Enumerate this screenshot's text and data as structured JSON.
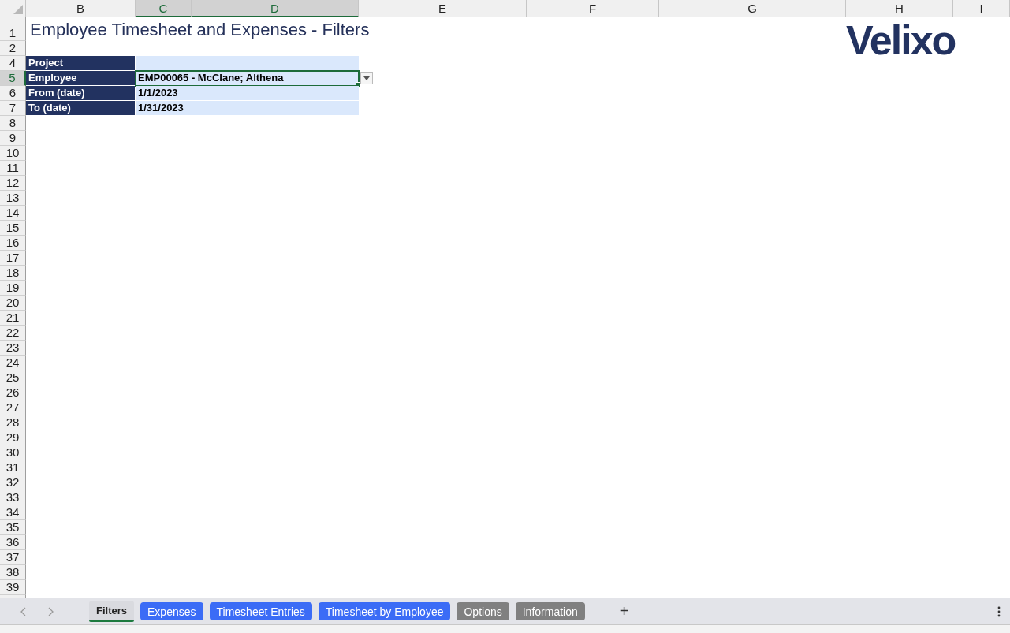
{
  "columns": [
    {
      "label": "B",
      "selected": false
    },
    {
      "label": "C",
      "selected": true
    },
    {
      "label": "D",
      "selected": true
    },
    {
      "label": "E",
      "selected": false
    },
    {
      "label": "F",
      "selected": false
    },
    {
      "label": "G",
      "selected": false
    },
    {
      "label": "H",
      "selected": false
    },
    {
      "label": "I",
      "selected": false
    }
  ],
  "rows": [
    {
      "label": "1",
      "selected": false
    },
    {
      "label": "2",
      "selected": false
    },
    {
      "label": "4",
      "selected": false
    },
    {
      "label": "5",
      "selected": true
    },
    {
      "label": "6",
      "selected": false
    },
    {
      "label": "7",
      "selected": false
    },
    {
      "label": "8",
      "selected": false
    },
    {
      "label": "9",
      "selected": false
    },
    {
      "label": "10",
      "selected": false
    },
    {
      "label": "11",
      "selected": false
    },
    {
      "label": "12",
      "selected": false
    },
    {
      "label": "13",
      "selected": false
    },
    {
      "label": "14",
      "selected": false
    },
    {
      "label": "15",
      "selected": false
    },
    {
      "label": "16",
      "selected": false
    },
    {
      "label": "17",
      "selected": false
    },
    {
      "label": "18",
      "selected": false
    },
    {
      "label": "19",
      "selected": false
    },
    {
      "label": "20",
      "selected": false
    },
    {
      "label": "21",
      "selected": false
    },
    {
      "label": "22",
      "selected": false
    },
    {
      "label": "23",
      "selected": false
    },
    {
      "label": "24",
      "selected": false
    },
    {
      "label": "25",
      "selected": false
    },
    {
      "label": "26",
      "selected": false
    },
    {
      "label": "27",
      "selected": false
    },
    {
      "label": "28",
      "selected": false
    },
    {
      "label": "29",
      "selected": false
    },
    {
      "label": "30",
      "selected": false
    },
    {
      "label": "31",
      "selected": false
    },
    {
      "label": "32",
      "selected": false
    },
    {
      "label": "33",
      "selected": false
    },
    {
      "label": "34",
      "selected": false
    },
    {
      "label": "35",
      "selected": false
    },
    {
      "label": "36",
      "selected": false
    },
    {
      "label": "37",
      "selected": false
    },
    {
      "label": "38",
      "selected": false
    },
    {
      "label": "39",
      "selected": false
    }
  ],
  "title": "Employee Timesheet and Expenses - Filters",
  "logo": "Velixo",
  "filters": [
    {
      "label": "Project",
      "selected": false
    },
    {
      "label": "Employee",
      "value": "EMP00065 - McClane; Althena",
      "selected": true
    },
    {
      "label": "From (date)",
      "value": "1/1/2023",
      "selected": false
    },
    {
      "label": "To (date)",
      "value": "1/31/2023",
      "selected": false
    }
  ],
  "sheet_tabs": [
    {
      "label": "Filters",
      "selected": true,
      "color": "#d9dadf"
    },
    {
      "label": "Expenses",
      "selected": false,
      "color": "#3b6cf6"
    },
    {
      "label": "Timesheet Entries",
      "selected": false,
      "color": "#3b6cf6"
    },
    {
      "label": "Timesheet by Employee",
      "selected": false,
      "color": "#3b6cf6"
    },
    {
      "label": "Options",
      "selected": false,
      "color": "#808080"
    },
    {
      "label": "Information",
      "selected": false,
      "color": "#808080"
    }
  ],
  "add_sheet": "+"
}
